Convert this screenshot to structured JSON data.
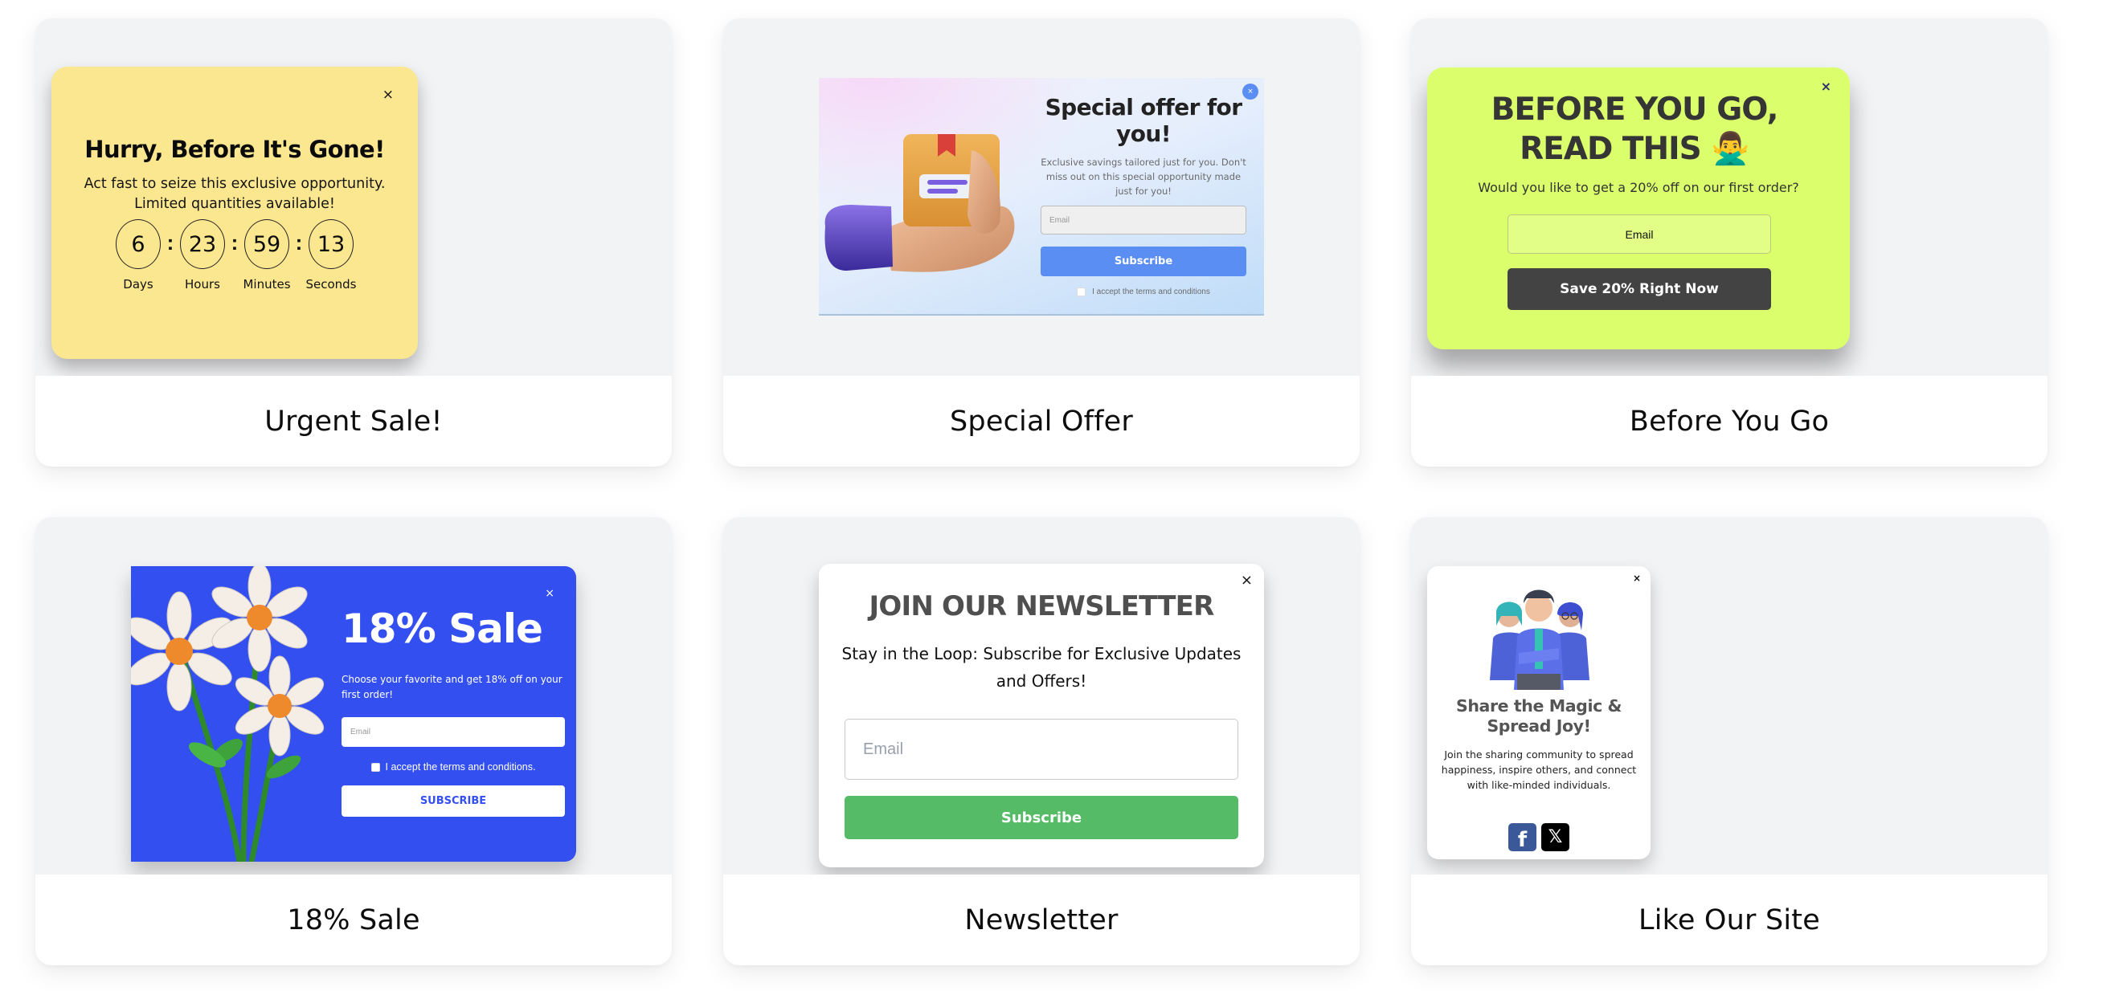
{
  "templates": [
    {
      "id": "urgent",
      "label": "Urgent Sale!",
      "popup": {
        "bg_color": "#fae78f",
        "close_icon": "close-icon",
        "title": "Hurry, Before It's Gone!",
        "subtitle": "Act fast to seize this exclusive opportunity. Limited quantities available!",
        "countdown": [
          {
            "value": "6",
            "unit": "Days"
          },
          {
            "value": "23",
            "unit": "Hours"
          },
          {
            "value": "59",
            "unit": "Minutes"
          },
          {
            "value": "13",
            "unit": "Seconds"
          }
        ],
        "separator": ":"
      }
    },
    {
      "id": "special",
      "label": "Special Offer",
      "popup": {
        "accent_color": "#5b8ef2",
        "close_icon": "close-icon",
        "illustration": "hand-holding-box-illustration",
        "title": "Special offer for you!",
        "subtitle": "Exclusive savings tailored just for you. Don't miss out on this special opportunity made just for you!",
        "email_placeholder": "Email",
        "button_label": "Subscribe",
        "terms_label": "I accept the terms and conditions"
      }
    },
    {
      "id": "before",
      "label": "Before You Go",
      "popup": {
        "bg_color": "#dbfe6c",
        "close_icon": "close-icon",
        "title": "BEFORE YOU GO, READ THIS 🙅‍♂️",
        "subtitle": "Would you like to get a 20% off on our first order?",
        "email_placeholder": "Email",
        "button_label": "Save 20% Right Now"
      }
    },
    {
      "id": "sale18",
      "label": "18% Sale",
      "popup": {
        "bg_color": "#334ff0",
        "close_icon": "close-icon",
        "illustration": "daisy-flowers-illustration",
        "title": "18% Sale",
        "subtitle": "Choose your favorite and get 18% off on your first order!",
        "email_placeholder": "Email",
        "terms_label": "I accept the terms and conditions.",
        "button_label": "SUBSCRIBE"
      }
    },
    {
      "id": "newsletter",
      "label": "Newsletter",
      "popup": {
        "accent_color": "#56bb66",
        "close_icon": "close-icon",
        "title": "JOIN OUR NEWSLETTER",
        "subtitle": "Stay in the Loop: Subscribe for Exclusive Updates and Offers!",
        "email_placeholder": "Email",
        "button_label": "Subscribe"
      }
    },
    {
      "id": "like",
      "label": "Like Our Site",
      "popup": {
        "close_icon": "close-icon",
        "illustration": "team-of-people-illustration",
        "title": "Share the Magic & Spread Joy!",
        "subtitle": "Join the sharing community to spread happiness, inspire others, and connect with like-minded individuals.",
        "socials": [
          {
            "name": "facebook-icon",
            "glyph": "f",
            "color": "#3b5998"
          },
          {
            "name": "x-icon",
            "glyph": "𝕏",
            "color": "#000000"
          }
        ]
      }
    }
  ],
  "close_glyph": "×"
}
